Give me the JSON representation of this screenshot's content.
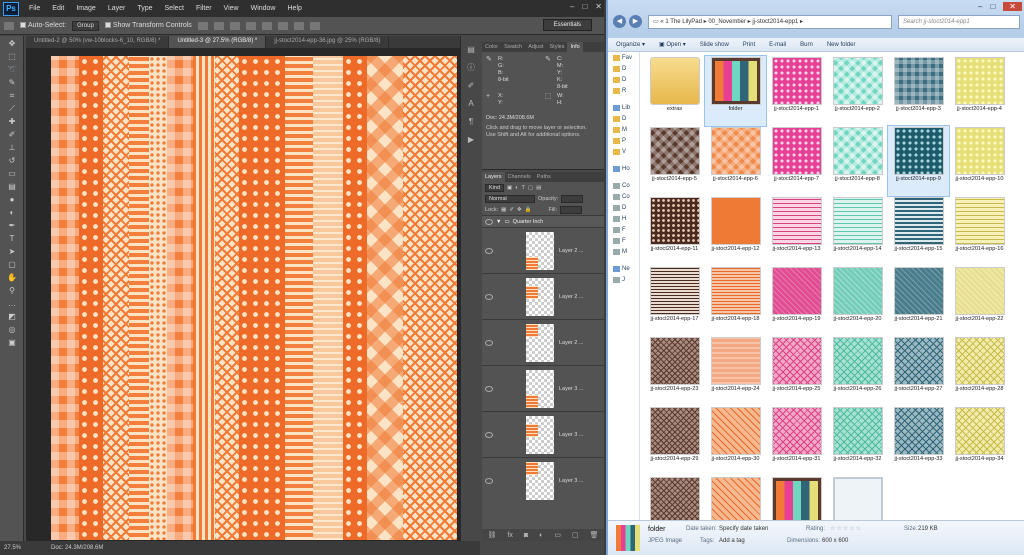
{
  "photoshop": {
    "logo": "Ps",
    "menu": [
      "File",
      "Edit",
      "Image",
      "Layer",
      "Type",
      "Select",
      "Filter",
      "View",
      "Window",
      "Help"
    ],
    "options": {
      "auto_select": "Auto-Select:",
      "group": "Group",
      "show_transform": "Show Transform Controls",
      "workspace": "Essentials"
    },
    "tabs": [
      "Untitled-2 @ 50% (vw-10blocks-6_10, RGB/8) *",
      "Untitled-3 @ 27.5% (RGB/8) *",
      "jj-stoct2014-epp-36.jpg @ 25% (RGB/8)"
    ],
    "status": {
      "zoom": "27.5%",
      "doc": "Doc: 24.3M/208.6M"
    },
    "panel_tabs": [
      "Color",
      "Swatch",
      "Adjust",
      "Styles",
      "Info"
    ],
    "info": {
      "r": "R:",
      "g": "G:",
      "b": "B:",
      "c": "C:",
      "m": "M:",
      "y": "Y:",
      "k": "K:",
      "bit1": "8-bit",
      "bit2": "8-bit",
      "x": "X:",
      "yy": "Y:",
      "w": "W:",
      "h": "H:",
      "doc": "Doc: 24.3M/208.6M",
      "msg": "Click and drag to move layer or selection.\nUse Shift and Alt for additional options."
    },
    "layers": {
      "tabs": [
        "Layers",
        "Channels",
        "Paths"
      ],
      "kind": "Kind",
      "blend": "Normal",
      "opacity_label": "Opacity:",
      "lock_label": "Lock:",
      "fill_label": "Fill:",
      "group_name": "Quarter Inch",
      "items": [
        "Layer 2 ...",
        "Layer 2 ...",
        "Layer 2 ...",
        "Layer 3 ...",
        "Layer 3 ...",
        "Layer 3 ..."
      ]
    }
  },
  "explorer": {
    "address": [
      "1 The LilyPad",
      "00_November",
      "jj-stoct2014-epp1"
    ],
    "search_placeholder": "Search jj-stoct2014-epp1",
    "toolbar": [
      "Organize",
      "Open",
      "Slide show",
      "Print",
      "E-mail",
      "Burn",
      "New folder"
    ],
    "nav": [
      {
        "label": "Fav",
        "icon": "star-icon"
      },
      {
        "label": "D",
        "icon": "folder-icon"
      },
      {
        "label": "D",
        "icon": "folder-icon"
      },
      {
        "label": "R",
        "icon": "folder-icon"
      },
      {
        "label": "Lib",
        "icon": "library-icon"
      },
      {
        "label": "D",
        "icon": "folder-icon"
      },
      {
        "label": "M",
        "icon": "folder-icon"
      },
      {
        "label": "P",
        "icon": "folder-icon"
      },
      {
        "label": "V",
        "icon": "folder-icon"
      },
      {
        "label": "Ho",
        "icon": "homegroup-icon"
      },
      {
        "label": "Co",
        "icon": "computer-icon"
      },
      {
        "label": "Co",
        "icon": "drive-icon"
      },
      {
        "label": "D",
        "icon": "drive-icon"
      },
      {
        "label": "H",
        "icon": "drive-icon"
      },
      {
        "label": "F",
        "icon": "drive-icon"
      },
      {
        "label": "F",
        "icon": "drive-icon"
      },
      {
        "label": "M",
        "icon": "drive-icon"
      },
      {
        "label": "Ne",
        "icon": "network-icon"
      },
      {
        "label": "J",
        "icon": "computer-icon"
      }
    ],
    "items": [
      {
        "name": "extras",
        "pattern": "p-extras"
      },
      {
        "name": "folder",
        "pattern": "p-folder-big",
        "selected": true
      },
      {
        "name": "jj-stoct2014-epp-1",
        "pattern": "p-pink"
      },
      {
        "name": "jj-stoct2014-epp-2",
        "pattern": "p-mint"
      },
      {
        "name": "jj-stoct2014-epp-3",
        "pattern": "p-teal"
      },
      {
        "name": "jj-stoct2014-epp-4",
        "pattern": "p-yellow"
      },
      {
        "name": "jj-stoct2014-epp-5",
        "pattern": "p-brown"
      },
      {
        "name": "jj-stoct2014-epp-6",
        "pattern": "p-orange"
      },
      {
        "name": "jj-stoct2014-epp-7",
        "pattern": "p-pink"
      },
      {
        "name": "jj-stoct2014-epp-8",
        "pattern": "p-mint"
      },
      {
        "name": "jj-stoct2014-epp-9",
        "pattern": "p-dkteal",
        "selected": true
      },
      {
        "name": "jj-stoct2014-epp-10",
        "pattern": "p-yellow"
      },
      {
        "name": "jj-stoct2014-epp-11",
        "pattern": "p-brown-dots"
      },
      {
        "name": "jj-stoct2014-epp-12",
        "pattern": "p-orange-solid"
      },
      {
        "name": "jj-stoct2014-epp-13",
        "pattern": "p-pink-line"
      },
      {
        "name": "jj-stoct2014-epp-14",
        "pattern": "p-mint-line"
      },
      {
        "name": "jj-stoct2014-epp-15",
        "pattern": "p-teal-line"
      },
      {
        "name": "jj-stoct2014-epp-16",
        "pattern": "p-yel-line"
      },
      {
        "name": "jj-stoct2014-epp-17",
        "pattern": "p-brown-line"
      },
      {
        "name": "jj-stoct2014-epp-18",
        "pattern": "p-orange-line"
      },
      {
        "name": "jj-stoct2014-epp-19",
        "pattern": "p-pink-tex"
      },
      {
        "name": "jj-stoct2014-epp-20",
        "pattern": "p-mint-tex"
      },
      {
        "name": "jj-stoct2014-epp-21",
        "pattern": "p-teal-tex"
      },
      {
        "name": "jj-stoct2014-epp-22",
        "pattern": "p-yel-tex"
      },
      {
        "name": "jj-stoct2014-epp-23",
        "pattern": "p-brown-chev"
      },
      {
        "name": "jj-stoct2014-epp-24",
        "pattern": "p-peach"
      },
      {
        "name": "jj-stoct2014-epp-25",
        "pattern": "p-pink-chev"
      },
      {
        "name": "jj-stoct2014-epp-26",
        "pattern": "p-mint-chev"
      },
      {
        "name": "jj-stoct2014-epp-27",
        "pattern": "p-teal-chev"
      },
      {
        "name": "jj-stoct2014-epp-28",
        "pattern": "p-yel-chev"
      },
      {
        "name": "jj-stoct2014-epp-29",
        "pattern": "p-brown-chev"
      },
      {
        "name": "jj-stoct2014-epp-30",
        "pattern": "p-orange-chev"
      },
      {
        "name": "jj-stoct2014-epp-31",
        "pattern": "p-pink-chev"
      },
      {
        "name": "jj-stoct2014-epp-32",
        "pattern": "p-mint-chev"
      },
      {
        "name": "jj-stoct2014-epp-33",
        "pattern": "p-teal-chev"
      },
      {
        "name": "jj-stoct2014-epp-34",
        "pattern": "p-yel-chev"
      },
      {
        "name": "",
        "pattern": "p-brown-chev"
      },
      {
        "name": "",
        "pattern": "p-orange-chev"
      },
      {
        "name": "",
        "pattern": "p-folder-big"
      },
      {
        "name": "",
        "pattern": "p-file"
      }
    ],
    "details": {
      "name": "folder",
      "type": "JPEG Image",
      "date_taken_label": "Date taken:",
      "date_taken": "Specify date taken",
      "tags_label": "Tags:",
      "tags": "Add a tag",
      "rating_label": "Rating:",
      "dimensions_label": "Dimensions:",
      "dimensions": "600 x 600",
      "size_label": "Size:",
      "size": "219 KB"
    }
  },
  "colors": {
    "orange": "#f07a36",
    "cream": "#fbe3c5",
    "ps_dark": "#3c3c3c",
    "explorer_chrome": "#c9ddf2"
  }
}
